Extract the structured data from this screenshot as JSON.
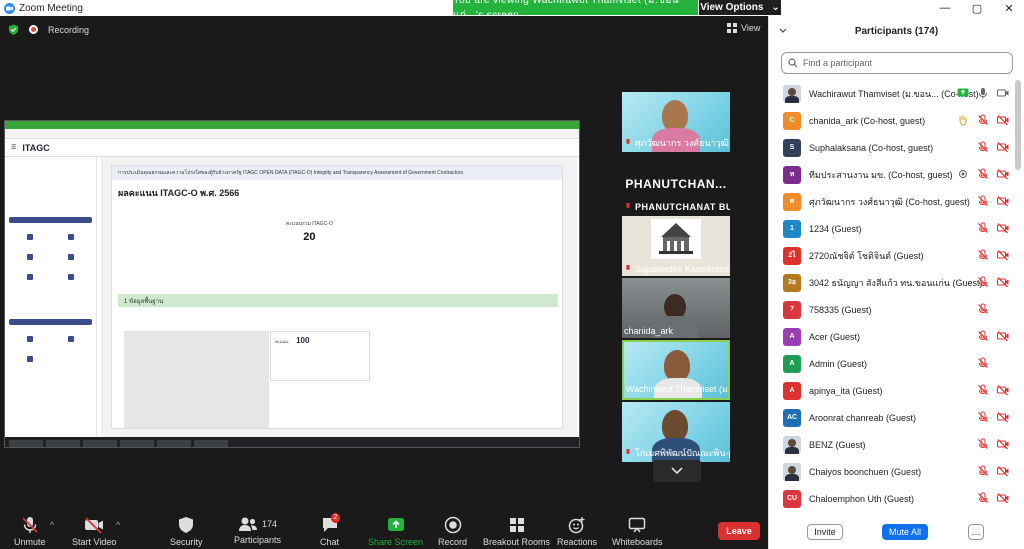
{
  "window": {
    "title": "Zoom Meeting",
    "banner": "You are viewing Wachirawut Thamviset (ม.ขอนแก่...'s screen",
    "view_options": "View Options"
  },
  "meeting": {
    "recording_label": "Recording",
    "view_label": "View"
  },
  "shared_screen": {
    "site_title": "ITAGC",
    "card_header": "การประเมินคุณธรรมและความโปร่งใสของผู้รับจ้างภาครัฐ ITAGC OPEN DATA (ITAGC-O) Integrity and Transparency Assessment of Government Contractors",
    "page_title": "ผลคะแนน ITAGC-O พ.ศ. 2566",
    "score_label": "คะแนนรวม ITAGC-O",
    "score_value": "20",
    "section_title": "1 ข้อมูลพื้นฐาน",
    "field_score_label": "คะแนน:",
    "field_score_value": "100"
  },
  "tiles": [
    {
      "name": "ศุภวัฒนากร วงศ์ธนาวุฒิ",
      "kind": "video"
    },
    {
      "name": "PHANUTCHANAT BUA...",
      "kind": "text",
      "big": "PHANUTCHAN..."
    },
    {
      "name": "Supawadee Kaewkums...",
      "kind": "image"
    },
    {
      "name": "chanida_ark",
      "kind": "video"
    },
    {
      "name": "Wachirawut Thamviset (ม.ข...",
      "kind": "video"
    },
    {
      "name": "โกเมศพิพัฒน์ปัณณะพิน-pr...",
      "kind": "video"
    }
  ],
  "participants": {
    "title": "Participants (174)",
    "search_placeholder": "Find a participant",
    "rows": [
      {
        "name": "Wachirawut Thamviset (ม.ขอน... (Co-host)",
        "avatar": "photo",
        "color": "#cfd6e0",
        "mic": "on",
        "cam": "on",
        "share": true
      },
      {
        "name": "chanida_ark (Co-host, guest)",
        "avatar": "C",
        "color": "#f28c28",
        "mic": "muted",
        "cam": "off",
        "hand": true
      },
      {
        "name": "Suphalaksana (Co-host, guest)",
        "avatar": "S",
        "color": "#2f3f5c",
        "mic": "muted",
        "cam": "off"
      },
      {
        "name": "ทีมประสานงาน มข. (Co-host, guest)",
        "avatar": "ท",
        "color": "#7b2d8e",
        "mic": "muted",
        "cam": "off",
        "dot": true
      },
      {
        "name": "ศุภวัฒนากร วงศ์ธนาวุฒิ (Co-host, guest)",
        "avatar": "ศ",
        "color": "#f28c28",
        "mic": "muted",
        "cam": "off"
      },
      {
        "name": "1234 (Guest)",
        "avatar": "1",
        "color": "#1e88c7",
        "mic": "muted",
        "cam": "off"
      },
      {
        "name": "2720ณัชจิต์ โชติจินต์ (Guest)",
        "avatar": "2ไ",
        "color": "#e03131",
        "mic": "muted",
        "cam": "off"
      },
      {
        "name": "3042 ธนัญญา สังสีแก้ว ทน.ขอนแก่น (Guest)",
        "avatar": "3อ",
        "color": "#b7791f",
        "mic": "muted",
        "cam": "off"
      },
      {
        "name": "758335 (Guest)",
        "avatar": "7",
        "color": "#d9363e",
        "mic": "muted",
        "cam": "none"
      },
      {
        "name": "Acer (Guest)",
        "avatar": "A",
        "color": "#9b3cb7",
        "mic": "muted",
        "cam": "off"
      },
      {
        "name": "Admin (Guest)",
        "avatar": "A",
        "color": "#1f9d55",
        "mic": "muted",
        "cam": "none"
      },
      {
        "name": "apinya_ita (Guest)",
        "avatar": "A",
        "color": "#e03131",
        "mic": "muted",
        "cam": "off"
      },
      {
        "name": "Aroonrat chanreab (Guest)",
        "avatar": "AC",
        "color": "#1e6fb8",
        "mic": "muted",
        "cam": "off"
      },
      {
        "name": "BENZ (Guest)",
        "avatar": "photo",
        "color": "#cfd6e0",
        "mic": "muted",
        "cam": "off"
      },
      {
        "name": "Chaiyos boonchuen (Guest)",
        "avatar": "photo",
        "color": "#cfd6e0",
        "mic": "muted",
        "cam": "off"
      },
      {
        "name": "Chaloemphon Uth (Guest)",
        "avatar": "CU",
        "color": "#d9363e",
        "mic": "muted",
        "cam": "off"
      }
    ],
    "invite": "Invite",
    "mute_all": "Mute All",
    "more": "…"
  },
  "toolbar": {
    "unmute": "Unmute",
    "start_video": "Start Video",
    "security": "Security",
    "participants": "Participants",
    "participants_count": "174",
    "chat": "Chat",
    "chat_badge": "2",
    "share_screen": "Share Screen",
    "record": "Record",
    "breakout_rooms": "Breakout Rooms",
    "reactions": "Reactions",
    "whiteboards": "Whiteboards",
    "leave": "Leave"
  },
  "colors": {
    "accent": "#0e72ed",
    "share_green": "#23b23c",
    "leave_red": "#d93131",
    "muted_red": "#e03131"
  }
}
